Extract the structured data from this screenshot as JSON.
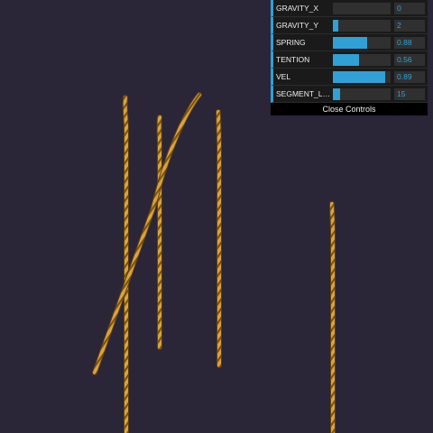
{
  "controls": [
    {
      "label": "GRAVITY_X",
      "value": "0",
      "fraction": 0.0
    },
    {
      "label": "GRAVITY_Y",
      "value": "2",
      "fraction": 0.1
    },
    {
      "label": "SPRING",
      "value": "0.88",
      "fraction": 0.6
    },
    {
      "label": "TENTION",
      "value": "0.56",
      "fraction": 0.45
    },
    {
      "label": "VEL",
      "value": "0.89",
      "fraction": 0.9
    },
    {
      "label": "SEGMENT_LEN...",
      "value": "15",
      "fraction": 0.12
    }
  ],
  "close_label": "Close Controls",
  "colors": {
    "background": "#2b2538",
    "rope": "#d9a340",
    "rope_dark": "#6b4a14",
    "accent": "#2fa1d6"
  }
}
